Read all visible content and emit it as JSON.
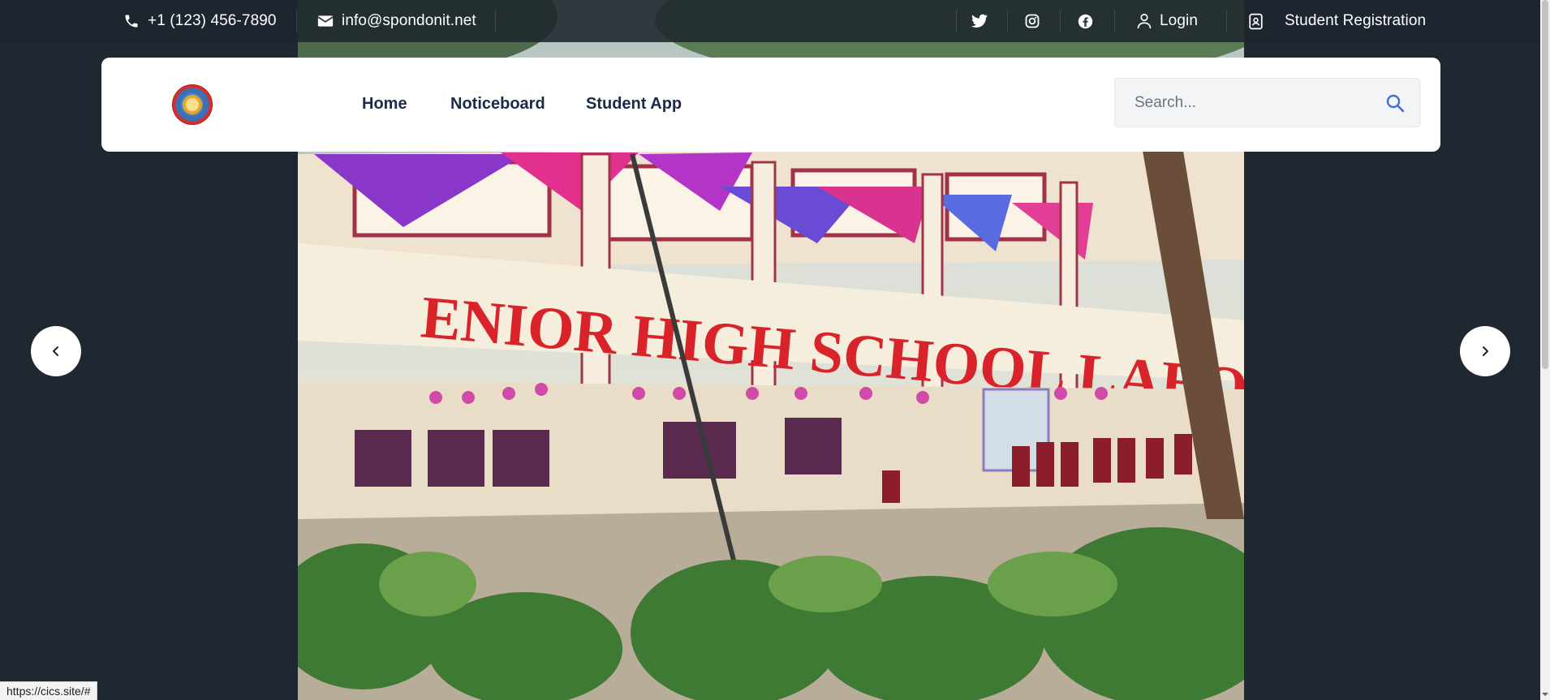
{
  "topbar": {
    "phone": "+1 (123) 456-7890",
    "email": "info@spondonit.net",
    "login": "Login",
    "registration": "Student Registration",
    "social_icons": [
      "twitter-icon",
      "instagram-icon",
      "facebook-icon"
    ]
  },
  "nav": {
    "items": [
      {
        "label": "Home"
      },
      {
        "label": "Noticeboard"
      },
      {
        "label": "Student App"
      }
    ],
    "search_placeholder": "Search..."
  },
  "hero": {
    "building_sign": "ENIOR HIGH SCHOOL LABORAT"
  },
  "status_url": "https://cics.site/#",
  "colors": {
    "page_bg": "#1f2730",
    "nav_text": "#1b2a4a",
    "search_icon": "#3b6fd8",
    "sign_red": "#d8232a"
  }
}
